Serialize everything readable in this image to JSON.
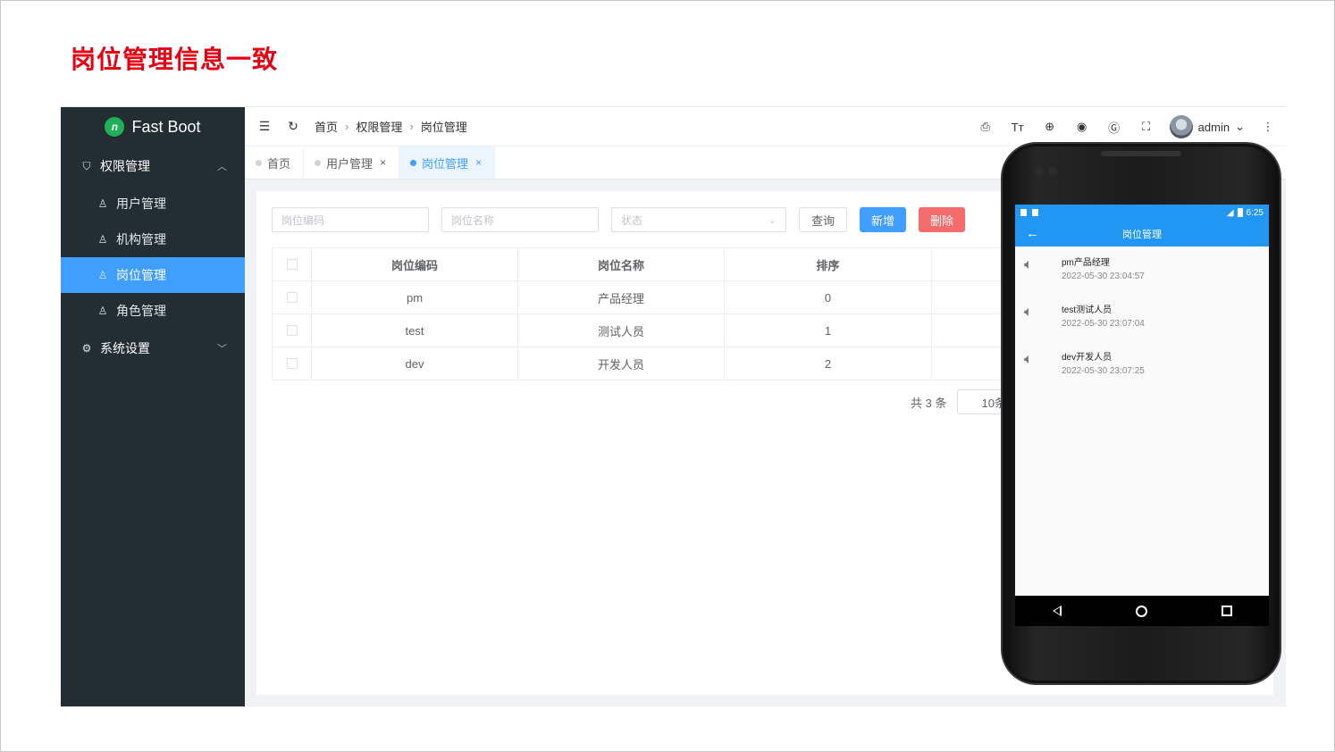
{
  "slide_title": "岗位管理信息一致",
  "app": {
    "logo": "Fast Boot",
    "logo_mark": "n",
    "menu": {
      "group1": "权限管理",
      "items": [
        "用户管理",
        "机构管理",
        "岗位管理",
        "角色管理"
      ],
      "group2": "系统设置"
    },
    "breadcrumb": [
      "首页",
      "权限管理",
      "岗位管理"
    ],
    "header_user": "admin",
    "tabs": [
      {
        "label": "首页"
      },
      {
        "label": "用户管理",
        "close": "×"
      },
      {
        "label": "岗位管理",
        "close": "×"
      }
    ],
    "filters": {
      "code_placeholder": "岗位编码",
      "name_placeholder": "岗位名称",
      "status_placeholder": "状态",
      "query": "查询",
      "add": "新增",
      "delete": "删除"
    },
    "table": {
      "headers": [
        "岗位编码",
        "岗位名称",
        "排序"
      ],
      "rows": [
        {
          "code": "pm",
          "name": "产品经理",
          "sort": "0"
        },
        {
          "code": "test",
          "name": "测试人员",
          "sort": "1"
        },
        {
          "code": "dev",
          "name": "开发人员",
          "sort": "2"
        }
      ]
    },
    "pagination": {
      "total": "共 3 条",
      "page_size": "10条"
    }
  },
  "phone": {
    "time": "6:25",
    "title": "岗位管理",
    "messages": [
      {
        "title": "pm产品经理",
        "time": "2022-05-30 23:04:57"
      },
      {
        "title": "test测试人员",
        "time": "2022-05-30 23:07:04"
      },
      {
        "title": "dev开发人员",
        "time": "2022-05-30 23:07:25"
      }
    ]
  },
  "colors": {
    "title_red": "#e60012",
    "primary": "#409eff",
    "danger": "#f56c6c",
    "sidebar": "#222d34",
    "android_blue": "#2196f3"
  },
  "icons": [
    "logo-icon",
    "shield-icon",
    "user-icon",
    "org-icon",
    "post-icon",
    "role-icon",
    "gear-icon",
    "chevron-up-icon",
    "chevron-down-icon",
    "menu-fold-icon",
    "refresh-icon",
    "screenshot-icon",
    "font-size-icon",
    "globe-icon",
    "github-icon",
    "g-icon",
    "fullscreen-icon",
    "more-icon",
    "speaker-icon",
    "back-arrow-icon"
  ]
}
